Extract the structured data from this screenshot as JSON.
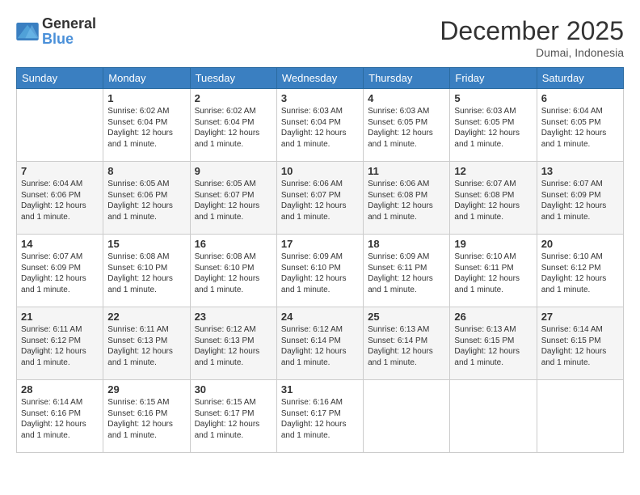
{
  "logo": {
    "general": "General",
    "blue": "Blue"
  },
  "title": {
    "month_year": "December 2025",
    "location": "Dumai, Indonesia"
  },
  "headers": [
    "Sunday",
    "Monday",
    "Tuesday",
    "Wednesday",
    "Thursday",
    "Friday",
    "Saturday"
  ],
  "weeks": [
    [
      {
        "day": "",
        "info": ""
      },
      {
        "day": "1",
        "info": "Sunrise: 6:02 AM\nSunset: 6:04 PM\nDaylight: 12 hours and 1 minute."
      },
      {
        "day": "2",
        "info": "Sunrise: 6:02 AM\nSunset: 6:04 PM\nDaylight: 12 hours and 1 minute."
      },
      {
        "day": "3",
        "info": "Sunrise: 6:03 AM\nSunset: 6:04 PM\nDaylight: 12 hours and 1 minute."
      },
      {
        "day": "4",
        "info": "Sunrise: 6:03 AM\nSunset: 6:05 PM\nDaylight: 12 hours and 1 minute."
      },
      {
        "day": "5",
        "info": "Sunrise: 6:03 AM\nSunset: 6:05 PM\nDaylight: 12 hours and 1 minute."
      },
      {
        "day": "6",
        "info": "Sunrise: 6:04 AM\nSunset: 6:05 PM\nDaylight: 12 hours and 1 minute."
      }
    ],
    [
      {
        "day": "7",
        "info": "Sunrise: 6:04 AM\nSunset: 6:06 PM\nDaylight: 12 hours and 1 minute."
      },
      {
        "day": "8",
        "info": "Sunrise: 6:05 AM\nSunset: 6:06 PM\nDaylight: 12 hours and 1 minute."
      },
      {
        "day": "9",
        "info": "Sunrise: 6:05 AM\nSunset: 6:07 PM\nDaylight: 12 hours and 1 minute."
      },
      {
        "day": "10",
        "info": "Sunrise: 6:06 AM\nSunset: 6:07 PM\nDaylight: 12 hours and 1 minute."
      },
      {
        "day": "11",
        "info": "Sunrise: 6:06 AM\nSunset: 6:08 PM\nDaylight: 12 hours and 1 minute."
      },
      {
        "day": "12",
        "info": "Sunrise: 6:07 AM\nSunset: 6:08 PM\nDaylight: 12 hours and 1 minute."
      },
      {
        "day": "13",
        "info": "Sunrise: 6:07 AM\nSunset: 6:09 PM\nDaylight: 12 hours and 1 minute."
      }
    ],
    [
      {
        "day": "14",
        "info": "Sunrise: 6:07 AM\nSunset: 6:09 PM\nDaylight: 12 hours and 1 minute."
      },
      {
        "day": "15",
        "info": "Sunrise: 6:08 AM\nSunset: 6:10 PM\nDaylight: 12 hours and 1 minute."
      },
      {
        "day": "16",
        "info": "Sunrise: 6:08 AM\nSunset: 6:10 PM\nDaylight: 12 hours and 1 minute."
      },
      {
        "day": "17",
        "info": "Sunrise: 6:09 AM\nSunset: 6:10 PM\nDaylight: 12 hours and 1 minute."
      },
      {
        "day": "18",
        "info": "Sunrise: 6:09 AM\nSunset: 6:11 PM\nDaylight: 12 hours and 1 minute."
      },
      {
        "day": "19",
        "info": "Sunrise: 6:10 AM\nSunset: 6:11 PM\nDaylight: 12 hours and 1 minute."
      },
      {
        "day": "20",
        "info": "Sunrise: 6:10 AM\nSunset: 6:12 PM\nDaylight: 12 hours and 1 minute."
      }
    ],
    [
      {
        "day": "21",
        "info": "Sunrise: 6:11 AM\nSunset: 6:12 PM\nDaylight: 12 hours and 1 minute."
      },
      {
        "day": "22",
        "info": "Sunrise: 6:11 AM\nSunset: 6:13 PM\nDaylight: 12 hours and 1 minute."
      },
      {
        "day": "23",
        "info": "Sunrise: 6:12 AM\nSunset: 6:13 PM\nDaylight: 12 hours and 1 minute."
      },
      {
        "day": "24",
        "info": "Sunrise: 6:12 AM\nSunset: 6:14 PM\nDaylight: 12 hours and 1 minute."
      },
      {
        "day": "25",
        "info": "Sunrise: 6:13 AM\nSunset: 6:14 PM\nDaylight: 12 hours and 1 minute."
      },
      {
        "day": "26",
        "info": "Sunrise: 6:13 AM\nSunset: 6:15 PM\nDaylight: 12 hours and 1 minute."
      },
      {
        "day": "27",
        "info": "Sunrise: 6:14 AM\nSunset: 6:15 PM\nDaylight: 12 hours and 1 minute."
      }
    ],
    [
      {
        "day": "28",
        "info": "Sunrise: 6:14 AM\nSunset: 6:16 PM\nDaylight: 12 hours and 1 minute."
      },
      {
        "day": "29",
        "info": "Sunrise: 6:15 AM\nSunset: 6:16 PM\nDaylight: 12 hours and 1 minute."
      },
      {
        "day": "30",
        "info": "Sunrise: 6:15 AM\nSunset: 6:17 PM\nDaylight: 12 hours and 1 minute."
      },
      {
        "day": "31",
        "info": "Sunrise: 6:16 AM\nSunset: 6:17 PM\nDaylight: 12 hours and 1 minute."
      },
      {
        "day": "",
        "info": ""
      },
      {
        "day": "",
        "info": ""
      },
      {
        "day": "",
        "info": ""
      }
    ]
  ]
}
